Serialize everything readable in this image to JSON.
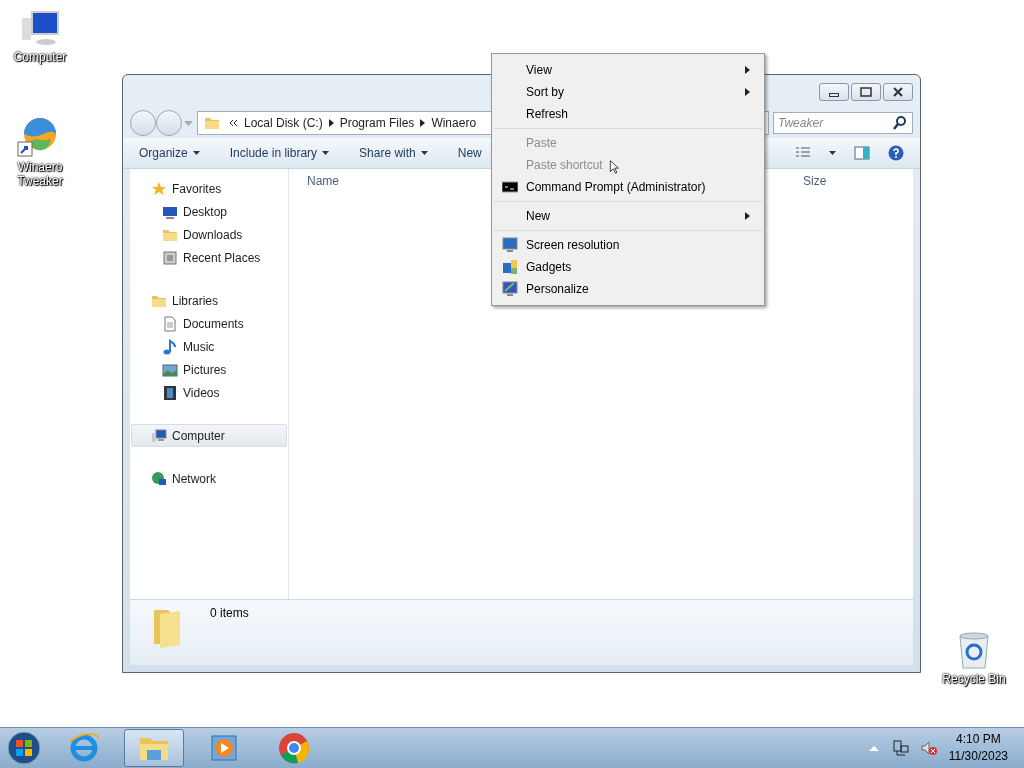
{
  "desktop_icons": [
    {
      "label": "Computer",
      "kind": "computer"
    },
    {
      "label": "Winaero Tweaker",
      "kind": "app"
    },
    {
      "label": "Recycle Bin",
      "kind": "bin"
    }
  ],
  "explorer": {
    "breadcrumb": [
      "Local Disk (C:)",
      "Program Files",
      "Winaero"
    ],
    "search_placeholder": "Tweaker",
    "toolbar": [
      "Organize",
      "Include in library",
      "Share with",
      "New"
    ],
    "nav": [
      {
        "label": "Favorites",
        "selected": false,
        "children": [
          {
            "label": "Desktop",
            "selected": false
          },
          {
            "label": "Downloads",
            "selected": false
          },
          {
            "label": "Recent Places",
            "selected": false
          }
        ]
      },
      {
        "label": "Libraries",
        "selected": false,
        "children": [
          {
            "label": "Documents",
            "selected": false
          },
          {
            "label": "Music",
            "selected": false
          },
          {
            "label": "Pictures",
            "selected": false
          },
          {
            "label": "Videos",
            "selected": false
          }
        ]
      },
      {
        "label": "Computer",
        "selected": true
      },
      {
        "label": "Network",
        "selected": false
      }
    ],
    "columns": [
      "Name",
      "Size"
    ],
    "status": "0 items"
  },
  "context_menu": [
    [
      {
        "label": "View",
        "kind": "submenu",
        "disabled": false
      },
      {
        "label": "Sort by",
        "kind": "submenu",
        "disabled": false
      },
      {
        "label": "Refresh",
        "kind": "plain",
        "disabled": false
      }
    ],
    [
      {
        "label": "Paste",
        "kind": "plain",
        "disabled": true
      },
      {
        "label": "Paste shortcut",
        "kind": "plain",
        "disabled": true
      },
      {
        "label": "Command Prompt (Administrator)",
        "kind": "console",
        "disabled": false
      }
    ],
    [
      {
        "label": "New",
        "kind": "submenu",
        "disabled": false
      }
    ],
    [
      {
        "label": "Screen resolution",
        "kind": "monitor",
        "disabled": false
      },
      {
        "label": "Gadgets",
        "kind": "gadget",
        "disabled": false
      },
      {
        "label": "Personalize",
        "kind": "paint",
        "disabled": false
      }
    ]
  ],
  "taskbar": {
    "apps": [
      {
        "kind": "browser",
        "selected": false
      },
      {
        "kind": "explorer",
        "selected": true
      },
      {
        "kind": "media",
        "selected": false
      },
      {
        "kind": "chrome",
        "selected": false
      }
    ],
    "time": "4:10 PM",
    "date": "11/30/2023"
  }
}
